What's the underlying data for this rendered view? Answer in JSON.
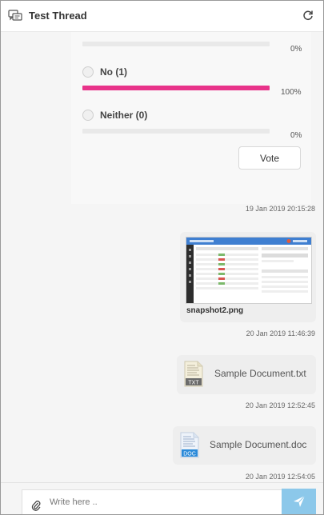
{
  "header": {
    "title": "Test Thread",
    "icons": {
      "thread": "chat-bubbles-icon",
      "refresh": "refresh-icon"
    }
  },
  "poll": {
    "options": [
      {
        "label": "",
        "percent_label": "0%",
        "fraction": 0
      },
      {
        "label": "No (1)",
        "percent_label": "100%",
        "fraction": 1
      },
      {
        "label": "Neither (0)",
        "percent_label": "0%",
        "fraction": 0
      }
    ],
    "vote_label": "Vote",
    "accent_color": "#e8338a"
  },
  "messages": [
    {
      "type": "poll",
      "timestamp": "19 Jan 2019 20:15:28"
    },
    {
      "type": "image",
      "filename": "snapshot2.png",
      "timestamp": "20 Jan 2019 11:46:39"
    },
    {
      "type": "file",
      "filename": "Sample Document.txt",
      "file_icon": "txt-file-icon",
      "icon_label": "TXT",
      "timestamp": "20 Jan 2019 12:52:45"
    },
    {
      "type": "file",
      "filename": "Sample Document.doc",
      "file_icon": "doc-file-icon",
      "icon_label": "DOC",
      "timestamp": "20 Jan 2019 12:54:05"
    }
  ],
  "composer": {
    "placeholder": "Write here ..",
    "value": "",
    "icons": {
      "attach": "paperclip-icon",
      "send": "send-icon"
    },
    "send_color": "#8cc8ea"
  }
}
